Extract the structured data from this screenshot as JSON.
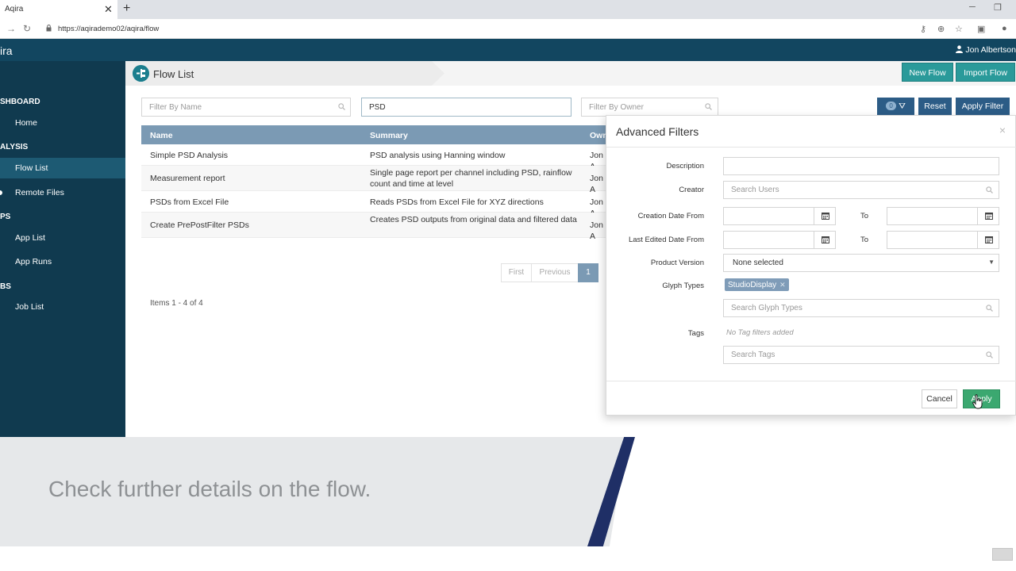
{
  "browser": {
    "tab_title": "Aqira",
    "tab_close": "✕",
    "new_tab": "+",
    "url": "https://aqirademo02/aqira/flow",
    "minimize": "─",
    "restore": "❐"
  },
  "app": {
    "brand": "ira",
    "user_name": "Jon Albertson"
  },
  "sidebar": {
    "sections": [
      {
        "heading": "SHBOARD",
        "items": [
          "Home"
        ]
      },
      {
        "heading": "ALYSIS",
        "items": [
          "Flow List",
          "Remote Files"
        ]
      },
      {
        "heading": "PS",
        "items": [
          "App List",
          "App Runs"
        ]
      },
      {
        "heading": "BS",
        "items": [
          "Job List"
        ]
      }
    ],
    "active_item": "Flow List"
  },
  "page": {
    "title": "Flow List",
    "new_flow_label": "New Flow",
    "import_flow_label": "Import Flow"
  },
  "filters": {
    "name_placeholder": "Filter By Name",
    "summary_value": "PSD",
    "owner_placeholder": "Filter By Owner",
    "active_count": "0",
    "reset_label": "Reset",
    "apply_label": "Apply Filter"
  },
  "table": {
    "headers": [
      "Name",
      "Summary",
      "Own"
    ],
    "rows": [
      {
        "name": "Simple PSD Analysis",
        "summary": "PSD analysis using Hanning window",
        "owner": "Jon A"
      },
      {
        "name": "Measurement report",
        "summary": "Single page report per channel including PSD, rainflow count and time at level",
        "owner": "Jon A"
      },
      {
        "name": "PSDs from Excel File",
        "summary": "Reads PSDs from Excel File for XYZ directions",
        "owner": "Jon A"
      },
      {
        "name": "Create PrePostFilter PSDs",
        "summary": "Creates PSD outputs from original data and filtered data",
        "owner": "Jon A"
      }
    ]
  },
  "pagination": {
    "first": "First",
    "previous": "Previous",
    "current": "1",
    "items_text": "Items 1 - 4 of 4"
  },
  "advanced_filters": {
    "title": "Advanced Filters",
    "close": "×",
    "description_label": "Description",
    "description_value": "",
    "creator_label": "Creator",
    "creator_placeholder": "Search Users",
    "creation_date_label": "Creation Date From",
    "last_edited_label": "Last Edited Date From",
    "to_label": "To",
    "product_version_label": "Product Version",
    "product_version_value": "None selected",
    "glyph_types_label": "Glyph Types",
    "glyph_tag": "StudioDisplay",
    "glyph_placeholder": "Search Glyph Types",
    "tags_label": "Tags",
    "tags_note": "No Tag filters added",
    "tags_placeholder": "Search Tags",
    "cancel_label": "Cancel",
    "apply_label": "Apply"
  },
  "caption": {
    "text": "Check further details on the flow."
  },
  "colors": {
    "header": "#124660",
    "sidebar": "#103a4f",
    "teal_button": "#2a9a9a",
    "navy_button": "#2c5c86",
    "table_header": "#7b9ab4",
    "apply_green": "#3ba870",
    "caption_stripe": "#1f2f66"
  }
}
